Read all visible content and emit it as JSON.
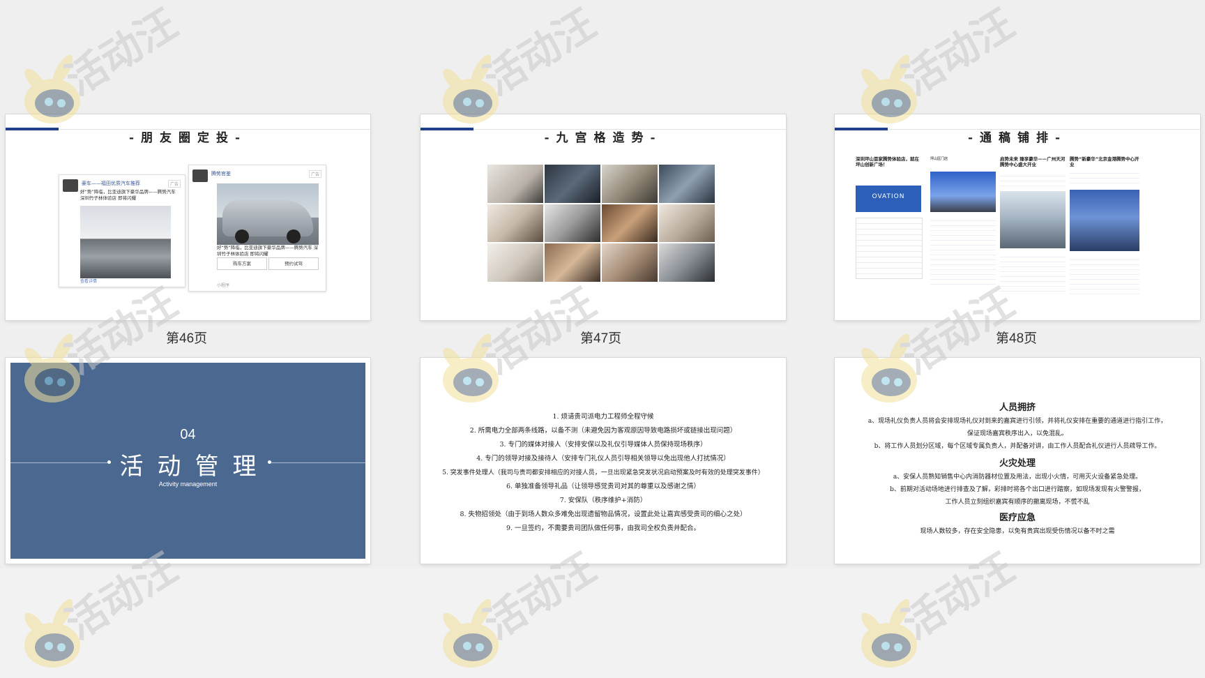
{
  "slides": [
    {
      "page_label": "第46页",
      "title": "-朋友圈定投-",
      "posts": [
        {
          "name": "豪车——福田优质汽车推荐",
          "tag": "广告",
          "text": "好“势”降临，比亚迪旗下豪华品牌——腾势汽车 深圳竹子林体验店 即将闪耀",
          "footer": "查看详情"
        },
        {
          "name": "腾势官鉴",
          "tag": "广告",
          "text": "好“势”降临，比亚迪旗下豪华品牌——腾势汽车 深圳竹子林体验店 即将闪耀",
          "button1": "购车方案",
          "button2": "预约试驾",
          "footer": "小程序"
        }
      ]
    },
    {
      "page_label": "第47页",
      "title": "-九宫格造势-"
    },
    {
      "page_label": "第48页",
      "title": "-通稿铺排-",
      "articles": [
        {
          "headline": "深圳坪山首家腾势体验店，就在坪山创新广场！",
          "logo": "OVATION"
        },
        {
          "headline": "坪山区门店"
        },
        {
          "headline": "启势未来 臻享豪华——广州天河腾势中心盛大开业"
        },
        {
          "headline": "腾势“新豪华”北京金港腾势中心开业"
        }
      ]
    },
    {
      "number": "04",
      "title": "活动管理",
      "subtitle": "Activity management"
    },
    {
      "items": [
        "1. 烦请贵司派电力工程师全程守候",
        "2. 所需电力全部两条线路，以备不测（未避免因为客观原因导致电路损坏或链接出现问题）",
        "3. 专门的媒体对接人（安排安保以及礼仪引导媒体人员保持现场秩序）",
        "4. 专门的领导对接及接待人（安排专门礼仪人员引导相关领导以免出现他人打扰情况）",
        "5. 突发事件处理人（我司与贵司都安排相应的对接人员，一旦出现紧急突发状况启动预案及时有效的处理突发事件）",
        "6. 单独准备领导礼品（让领导感觉贵司对其的尊重以及感谢之情）",
        "7. 安保队（秩序维护+消防）",
        "8. 失物招领处（由于到场人数众多难免出现遗留物品情况，设置此处让嘉宾感受贵司的细心之处）",
        "9. 一旦签约，不需要贵司团队做任何事，由我司全权负责并配合。"
      ]
    },
    {
      "sections": [
        {
          "heading": "人员拥挤",
          "lines": [
            "a、现场礼仪负责人员将会安排现场礼仪对到来的嘉宾进行引领，并将礼仪安排在重要的通道进行指引工作，",
            "保证现场嘉宾秩序出入，以免混乱。",
            "b、将工作人员划分区域，每个区域专属负责人，并配备对讲，由工作人员配合礼仪进行人员疏导工作。"
          ]
        },
        {
          "heading": "火灾处理",
          "lines": [
            "a、安保人员熟知销售中心内消防器材位置及用法，出现小火情，可用灭火设备紧急处理。",
            "b、前期对活动场地进行排查及了解，彩排时将各个出口进行踏察，如现场发现有火警警报，",
            "工作人员立刻组织嘉宾有顺序的撤离现场，不慌不乱"
          ]
        },
        {
          "heading": "医疗应急",
          "lines": [
            "现场人数较多，存在安全隐患，以免有贵宾出现受伤情况以备不时之需"
          ]
        }
      ]
    }
  ],
  "watermark": "活动汪",
  "colors": {
    "accent": "#1f3f8a",
    "section_bg": "#4a6890",
    "background": "#efefef"
  }
}
